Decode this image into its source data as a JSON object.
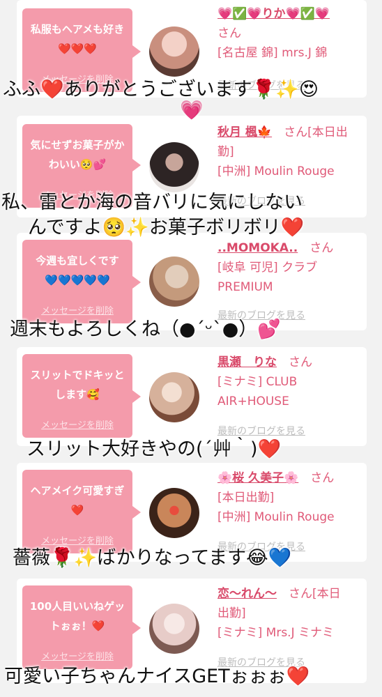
{
  "cards": [
    {
      "message": "私服もヘアメも好き❤️❤️❤️",
      "delete_label": "メッセージを削除",
      "name": "💗✅💗りか💗✅💗",
      "san": "さん",
      "status": "",
      "place": "[名古屋 錦] mrs.J 錦",
      "place2": "",
      "blog_label": "最新のブログを見る",
      "avatar_colors": [
        "#f3d1c7",
        "#c98f7e",
        "#5b3b33"
      ]
    },
    {
      "message": "気にせずお菓子がかわいい🥺💕",
      "delete_label": "メッセージを削除",
      "name": "秋月 楓🍁",
      "san": "さん[本日出",
      "status": "勤]",
      "place": "[中洲] Moulin Rouge",
      "place2": "",
      "blog_label": "最新のブログを見る",
      "avatar_colors": [
        "#e9e4e2",
        "#2d2424",
        "#c7a59a"
      ]
    },
    {
      "message": "今週も宜しくです💙💙💙💙💙",
      "delete_label": "メッセージを削除",
      "name": "..MOMOKA..",
      "san": "さん",
      "status": "",
      "place": "[岐阜 可児] クラブ",
      "place2": "PREMIUM",
      "blog_label": "最新のブログを見る",
      "avatar_colors": [
        "#e2cdbb",
        "#c49a7c",
        "#8a5e49"
      ]
    },
    {
      "message": "スリットでドキッとします🥰",
      "delete_label": "メッセージを削除",
      "name": "黒瀬　りな",
      "san": "さん",
      "status": "",
      "place": "[ミナミ] CLUB",
      "place2": "AIR+HOUSE",
      "blog_label": "最新のブログを見る",
      "avatar_colors": [
        "#d6b19b",
        "#7a4b38",
        "#f3dfd2"
      ]
    },
    {
      "message": "ヘアメイク可愛すぎ❤️",
      "delete_label": "メッセージを削除",
      "name": "🌸桜 久美子🌸",
      "san": "さん",
      "status": "[本日出勤]",
      "place": "[中洲] Moulin Rouge",
      "place2": "",
      "blog_label": "最新のブログを見る",
      "avatar_colors": [
        "#c9865a",
        "#3b2319",
        "#e84c3d"
      ]
    },
    {
      "message": "100人目いいねゲットぉぉ！❤️",
      "delete_label": "メッセージを削除",
      "name": "恋〜れん〜",
      "san": "さん[本日",
      "status": "出勤]",
      "place": "[ミナミ] Mrs.J ミナミ",
      "place2": "",
      "blog_label": "最新のブログを見る",
      "avatar_colors": [
        "#e7ccc8",
        "#7d5a52",
        "#f7e9e6"
      ]
    }
  ],
  "captions": [
    {
      "text": "ふふ❤️ありがとうございます🌹✨😍",
      "line2": "💗"
    },
    {
      "text": "私、雷とか海の音バリに気にしない",
      "line2": "んですよ🥺✨お菓子ボリボリ❤️"
    },
    {
      "text": "週末もよろしくね（●ˊᵕˋ●）💕",
      "line2": ""
    },
    {
      "text": "スリット大好きやの(´艸｀)❤️",
      "line2": ""
    },
    {
      "text": "薔薇🌹✨ばかりなってます😂💙",
      "line2": ""
    },
    {
      "text": "可愛い子ちゃんナイスGETぉぉぉ❤️",
      "line2": ""
    }
  ]
}
